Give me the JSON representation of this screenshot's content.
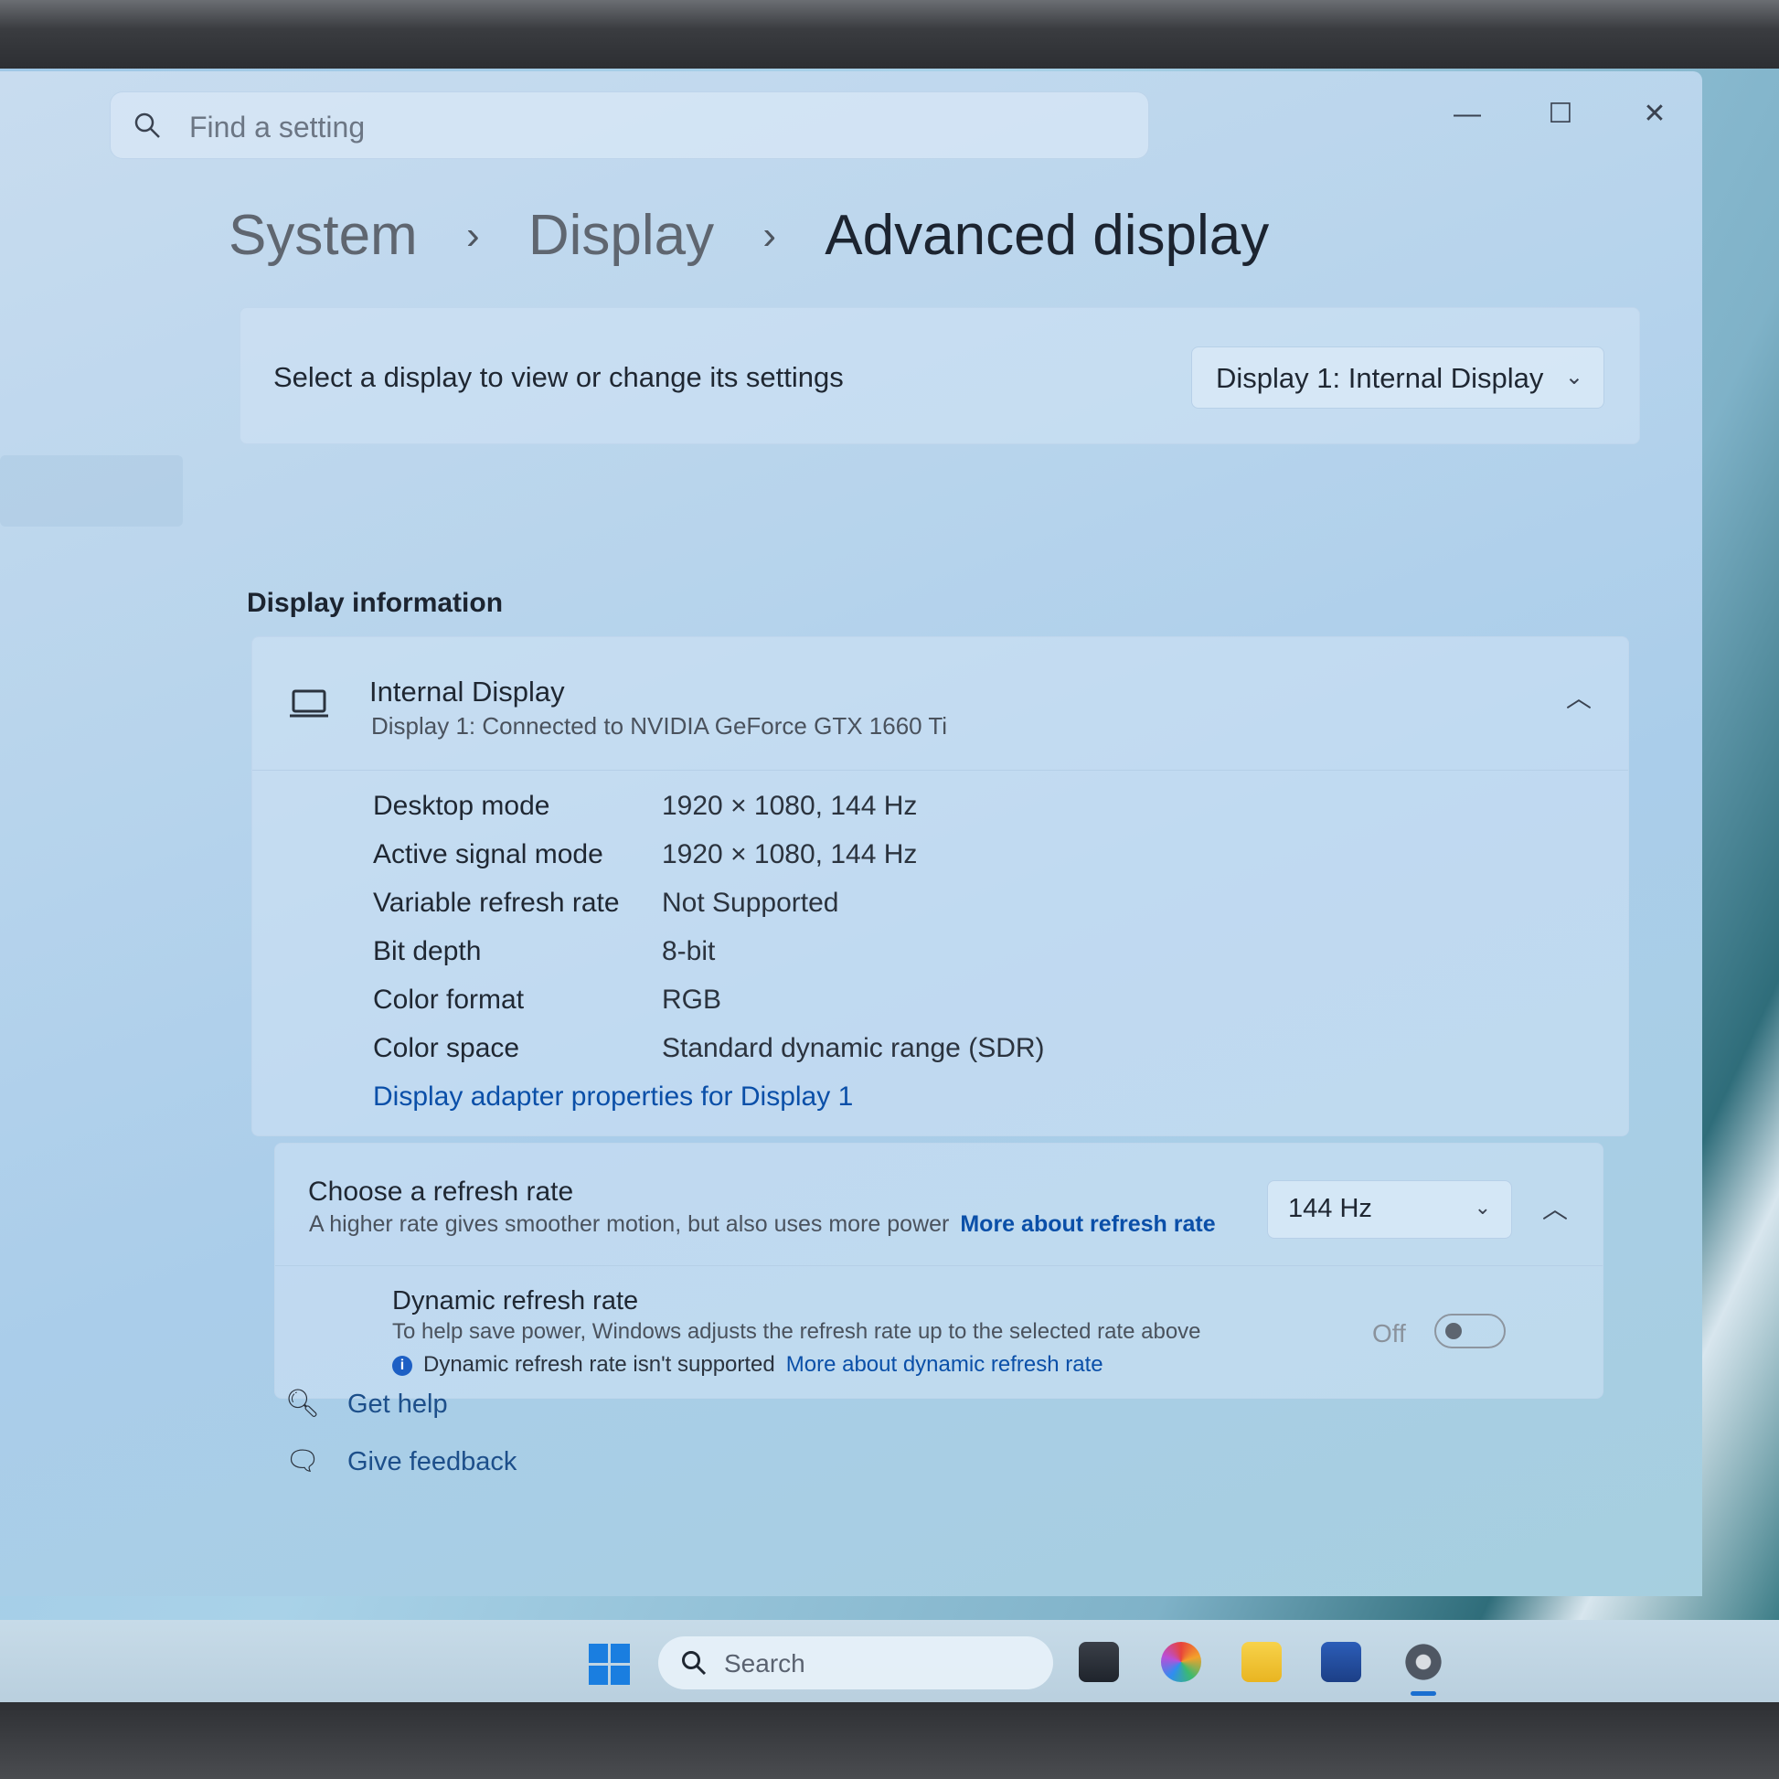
{
  "window": {
    "search_placeholder": "Find a setting",
    "controls": {
      "minimize": "—",
      "maximize": "☐",
      "close": "✕"
    }
  },
  "breadcrumb": {
    "items": [
      "System",
      "Display",
      "Advanced display"
    ],
    "separator": "›"
  },
  "display_select": {
    "label": "Select a display to view or change its settings",
    "selected": "Display 1: Internal Display"
  },
  "display_info": {
    "section_title": "Display information",
    "name": "Internal Display",
    "subtitle": "Display 1: Connected to NVIDIA GeForce GTX 1660 Ti",
    "rows": [
      {
        "label": "Desktop mode",
        "value": "1920 × 1080, 144 Hz"
      },
      {
        "label": "Active signal mode",
        "value": "1920 × 1080, 144 Hz"
      },
      {
        "label": "Variable refresh rate",
        "value": "Not Supported"
      },
      {
        "label": "Bit depth",
        "value": "8-bit"
      },
      {
        "label": "Color format",
        "value": "RGB"
      },
      {
        "label": "Color space",
        "value": "Standard dynamic range (SDR)"
      }
    ],
    "adapter_link": "Display adapter properties for Display 1"
  },
  "refresh_rate": {
    "title": "Choose a refresh rate",
    "subtitle": "A higher rate gives smoother motion, but also uses more power",
    "link": "More about refresh rate",
    "selected": "144 Hz",
    "dynamic": {
      "title": "Dynamic refresh rate",
      "subtitle": "To help save power, Windows adjusts the refresh rate up to the selected rate above",
      "note": "Dynamic refresh rate isn't supported",
      "link": "More about dynamic refresh rate",
      "toggle_label": "Off",
      "toggle_on": false
    }
  },
  "help": {
    "get_help": "Get help",
    "give_feedback": "Give feedback"
  },
  "taskbar": {
    "search_placeholder": "Search",
    "apps": [
      "start-icon",
      "task-view-icon",
      "copilot-icon",
      "file-explorer-icon",
      "store-icon",
      "settings-icon"
    ],
    "accent": "#1a6fd0"
  }
}
